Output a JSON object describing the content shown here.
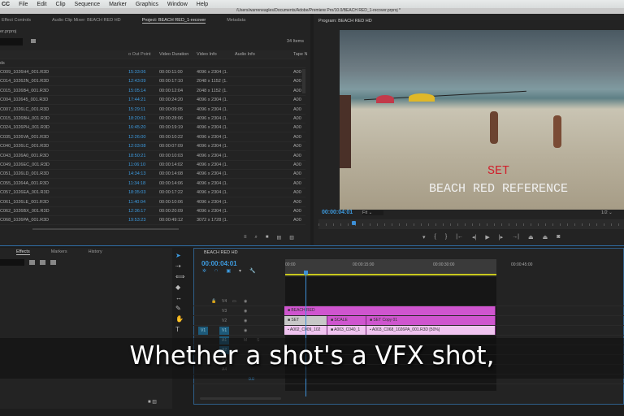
{
  "menu": [
    "CC",
    "File",
    "Edit",
    "Clip",
    "Sequence",
    "Marker",
    "Graphics",
    "Window",
    "Help"
  ],
  "window_title": "/Users/warreneagles/Documents/Adobe/Premiere Pro/10.0/BEACH RED_1-recover.prproj *",
  "project_panel": {
    "tabs": [
      "Effect Controls",
      "Audio Clip Mixer: BEACH RED HD",
      "Project: BEACH RED_1-recover",
      "Metadata"
    ],
    "file": "er.prproj",
    "item_count": "34 Items",
    "bin": "ds",
    "columns": [
      "o Out Point",
      "Video Duration",
      "Video Info",
      "Audio Info",
      "Tape N"
    ],
    "rows": [
      [
        "C009_1026H4_001.R3D",
        "15:33:06",
        "00:00:11:00",
        "4096 x 2304 (1.",
        "A00"
      ],
      [
        "C014_10262N_001.R3D",
        "12:43:09",
        "00:00:17:10",
        "2048 x 1152 (1.",
        "A00"
      ],
      [
        "C015_1026B4_001.R3D",
        "15:05:14",
        "00:00:12:04",
        "2048 x 1152 (1.",
        "A00"
      ],
      [
        "C004_102645_001.R3D",
        "17:44:21",
        "00:00:24:20",
        "4096 x 2304 (1.",
        "A00"
      ],
      [
        "C007_1026LC_001.R3D",
        "15:29:11",
        "00:00:09:05",
        "4096 x 2304 (1.",
        "A00"
      ],
      [
        "C015_1026BH_001.R3D",
        "18:20:01",
        "00:00:28:06",
        "4096 x 2304 (1.",
        "A00"
      ],
      [
        "C024_1026PH_001.R3D",
        "16:45:20",
        "00:00:19:19",
        "4096 x 2304 (1.",
        "A00"
      ],
      [
        "C035_1026VA_001.R3D",
        "12:26:00",
        "00:00:10:22",
        "4096 x 2304 (1.",
        "A00"
      ],
      [
        "C040_1026LC_001.R3D",
        "12:03:08",
        "00:00:07:09",
        "4096 x 2304 (1.",
        "A00"
      ],
      [
        "C043_1026A0_001.R3D",
        "18:50:21",
        "00:00:10:03",
        "4096 x 2304 (1.",
        "A00"
      ],
      [
        "C049_1026EC_001.R3D",
        "11:06:10",
        "00:00:14:02",
        "4096 x 2304 (1.",
        "A00"
      ],
      [
        "C051_1026LD_001.R3D",
        "14:34:13",
        "00:00:14:08",
        "4096 x 2304 (1.",
        "A00"
      ],
      [
        "C055_10264A_001.R3D",
        "11:34:18",
        "00:00:14:06",
        "4096 x 2304 (1.",
        "A00"
      ],
      [
        "C057_1026EA_001.R3D",
        "18:35:03",
        "00:00:17:22",
        "4096 x 2304 (1.",
        "A00"
      ],
      [
        "C061_1026LE_001.R3D",
        "11:40:04",
        "00:00:10:06",
        "4096 x 2304 (1.",
        "A00"
      ],
      [
        "C062_1026BX_001.R3D",
        "12:36:17",
        "00:00:20:09",
        "4096 x 2304 (1.",
        "A00"
      ],
      [
        "C068_1026PA_001.R3D",
        "19:53:23",
        "00:00:49:12",
        "3072 x 1728 (1.",
        "A00"
      ]
    ]
  },
  "program": {
    "title": "Program: BEACH RED HD",
    "timecode": "00:00:04:01",
    "fit": "Fit",
    "resolution": "1/2",
    "overlay_red": "SET",
    "overlay_white": "BEACH RED REFERENCE"
  },
  "effects_panel": {
    "tabs": [
      "Effects",
      "Markers",
      "History"
    ]
  },
  "timeline": {
    "title": "BEACH RED HD",
    "timecode": "00:00:04:01",
    "ruler": [
      "00:00",
      "00:00:15:00",
      "00:00:30:00",
      "00:00:45:00"
    ],
    "video_tracks": [
      "V4",
      "V3",
      "V2",
      "V1"
    ],
    "audio_tracks": [
      "A1",
      "A2",
      "A3",
      "A4"
    ],
    "source_patch": "V1",
    "master_value": "0.0",
    "clips": {
      "v3": "BEACH RED",
      "v2": [
        "SET",
        "SCALE",
        "SET Copy 01"
      ],
      "v1": [
        "A002_C009_102",
        "A003_C040_1",
        "A003_C068_1026PA_001.R3D [50%]"
      ]
    }
  },
  "subtitle": "Whether a shot's a VFX shot,",
  "colors": {
    "accent": "#3d9be0",
    "clip_magenta": "#cf55cf",
    "clip_pink": "#f0c4f0",
    "playhead": "#3d8fd6"
  }
}
